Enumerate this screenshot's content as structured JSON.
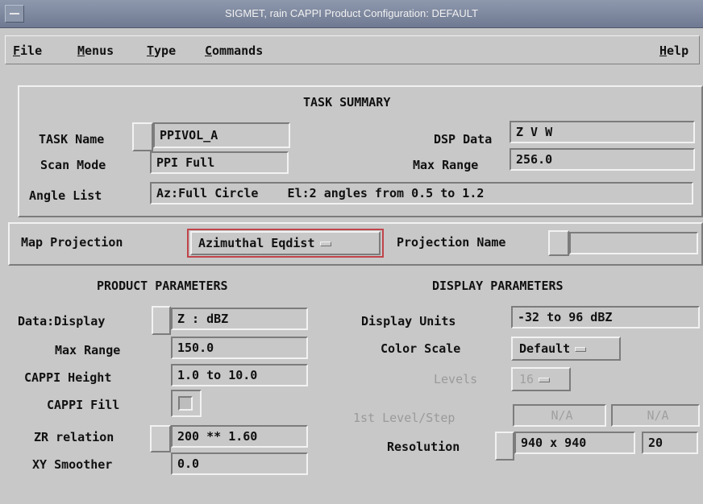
{
  "window": {
    "title": "SIGMET, rain  CAPPI Product Configuration: DEFAULT"
  },
  "menubar": {
    "file": {
      "hot": "F",
      "rest": "ile"
    },
    "menus": {
      "hot": "M",
      "rest": "enus"
    },
    "type": {
      "hot": "T",
      "rest": "ype"
    },
    "commands": {
      "hot": "C",
      "rest": "ommands"
    },
    "help": {
      "hot": "H",
      "rest": "elp"
    }
  },
  "task_summary": {
    "heading": "TASK SUMMARY",
    "task_name_label": "TASK Name",
    "task_name_value": "PPIVOL_A",
    "scan_mode_label": "Scan Mode",
    "scan_mode_value": "PPI Full",
    "angle_list_label": "Angle List",
    "angle_list_value": "Az:Full Circle    El:2 angles from 0.5 to 1.2",
    "dsp_data_label": "DSP Data",
    "dsp_data_value": "Z V W",
    "max_range_label": "Max Range",
    "max_range_value": "256.0"
  },
  "map": {
    "projection_label": "Map Projection",
    "projection_value": "Azimuthal Eqdist",
    "projection_name_label": "Projection Name",
    "projection_name_value": ""
  },
  "product_params": {
    "heading": "PRODUCT PARAMETERS",
    "data_display_label": "Data:Display",
    "data_display_value": "Z : dBZ",
    "max_range_label": "Max Range",
    "max_range_value": "150.0",
    "cappi_height_label": "CAPPI Height",
    "cappi_height_value": "1.0 to 10.0",
    "cappi_fill_label": "CAPPI Fill",
    "zr_relation_label": "ZR relation",
    "zr_relation_value": "200 ** 1.60",
    "xy_smoother_label": "XY Smoother",
    "xy_smoother_value": "0.0"
  },
  "display_params": {
    "heading": "DISPLAY PARAMETERS",
    "display_units_label": "Display Units",
    "display_units_value": "-32 to 96 dBZ",
    "color_scale_label": "Color Scale",
    "color_scale_value": "Default",
    "levels_label": "Levels",
    "levels_value": "16",
    "first_level_label": "1st Level/Step",
    "first_level_value": "N/A",
    "step_value": "N/A",
    "resolution_label": "Resolution",
    "resolution_value": "940 x 940",
    "resolution_extra": "20"
  }
}
